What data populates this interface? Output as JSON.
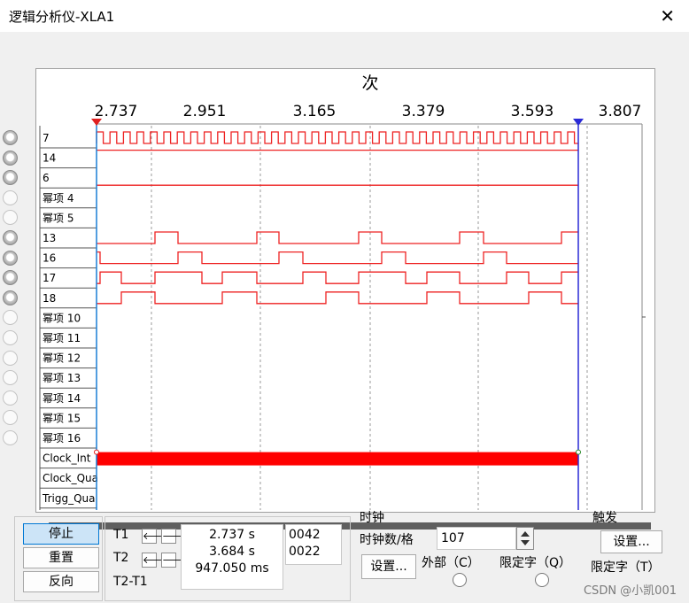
{
  "window": {
    "title": "逻辑分析仪-XLA1",
    "close_glyph": "✕"
  },
  "plot": {
    "top_label": "次",
    "time_ticks": [
      "2.737",
      "2.951",
      "3.165",
      "3.379",
      "3.593",
      "3.807"
    ],
    "trace_color": "#ee2222",
    "channels": [
      {
        "label": "7",
        "led": true,
        "wave": "clk"
      },
      {
        "label": "14",
        "led": true,
        "wave": "bus"
      },
      {
        "label": "6",
        "led": true,
        "wave": "flat"
      },
      {
        "label": "幂项 4",
        "led": false,
        "wave": "none"
      },
      {
        "label": "幂项 5",
        "led": false,
        "wave": "none"
      },
      {
        "label": "13",
        "led": true,
        "wave": "b13"
      },
      {
        "label": "16",
        "led": true,
        "wave": "b16"
      },
      {
        "label": "17",
        "led": true,
        "wave": "b17"
      },
      {
        "label": "18",
        "led": true,
        "wave": "b18"
      },
      {
        "label": "幂项 10",
        "led": false,
        "wave": "none"
      },
      {
        "label": "幂项 11",
        "led": false,
        "wave": "none"
      },
      {
        "label": "幂项 12",
        "led": false,
        "wave": "none"
      },
      {
        "label": "幂项 13",
        "led": false,
        "wave": "none"
      },
      {
        "label": "幂项 14",
        "led": false,
        "wave": "none"
      },
      {
        "label": "幂项 15",
        "led": false,
        "wave": "none"
      },
      {
        "label": "幂项 16",
        "led": false,
        "wave": "none"
      },
      {
        "label": "Clock_Int",
        "led": false,
        "wave": "clockint"
      },
      {
        "label": "Clock_Qua",
        "led": false,
        "wave": "none"
      },
      {
        "label": "Trigg_Qua",
        "led": false,
        "wave": "none"
      }
    ]
  },
  "controls": {
    "stop": "停止",
    "reset": "重置",
    "reverse": "反向",
    "t1": "T1",
    "t2": "T2",
    "t2t1": "T2-T1",
    "t1_time": "2.737 s",
    "t2_time": "3.684 s",
    "delta_time": "947.050 ms",
    "t1_hex": "0042",
    "t2_hex": "0022",
    "left_arrow": "🡐",
    "right_arrow": "🡒"
  },
  "clock": {
    "heading": "时钟",
    "per_div_label": "时钟数/格",
    "per_div_value": "107",
    "set_button": "设置...",
    "external": "外部（C）",
    "qualifier": "限定字（Q）"
  },
  "trigger": {
    "heading": "触发",
    "set_button": "设置...",
    "qualifier": "限定字（T）"
  },
  "watermark": "CSDN @小凯001"
}
